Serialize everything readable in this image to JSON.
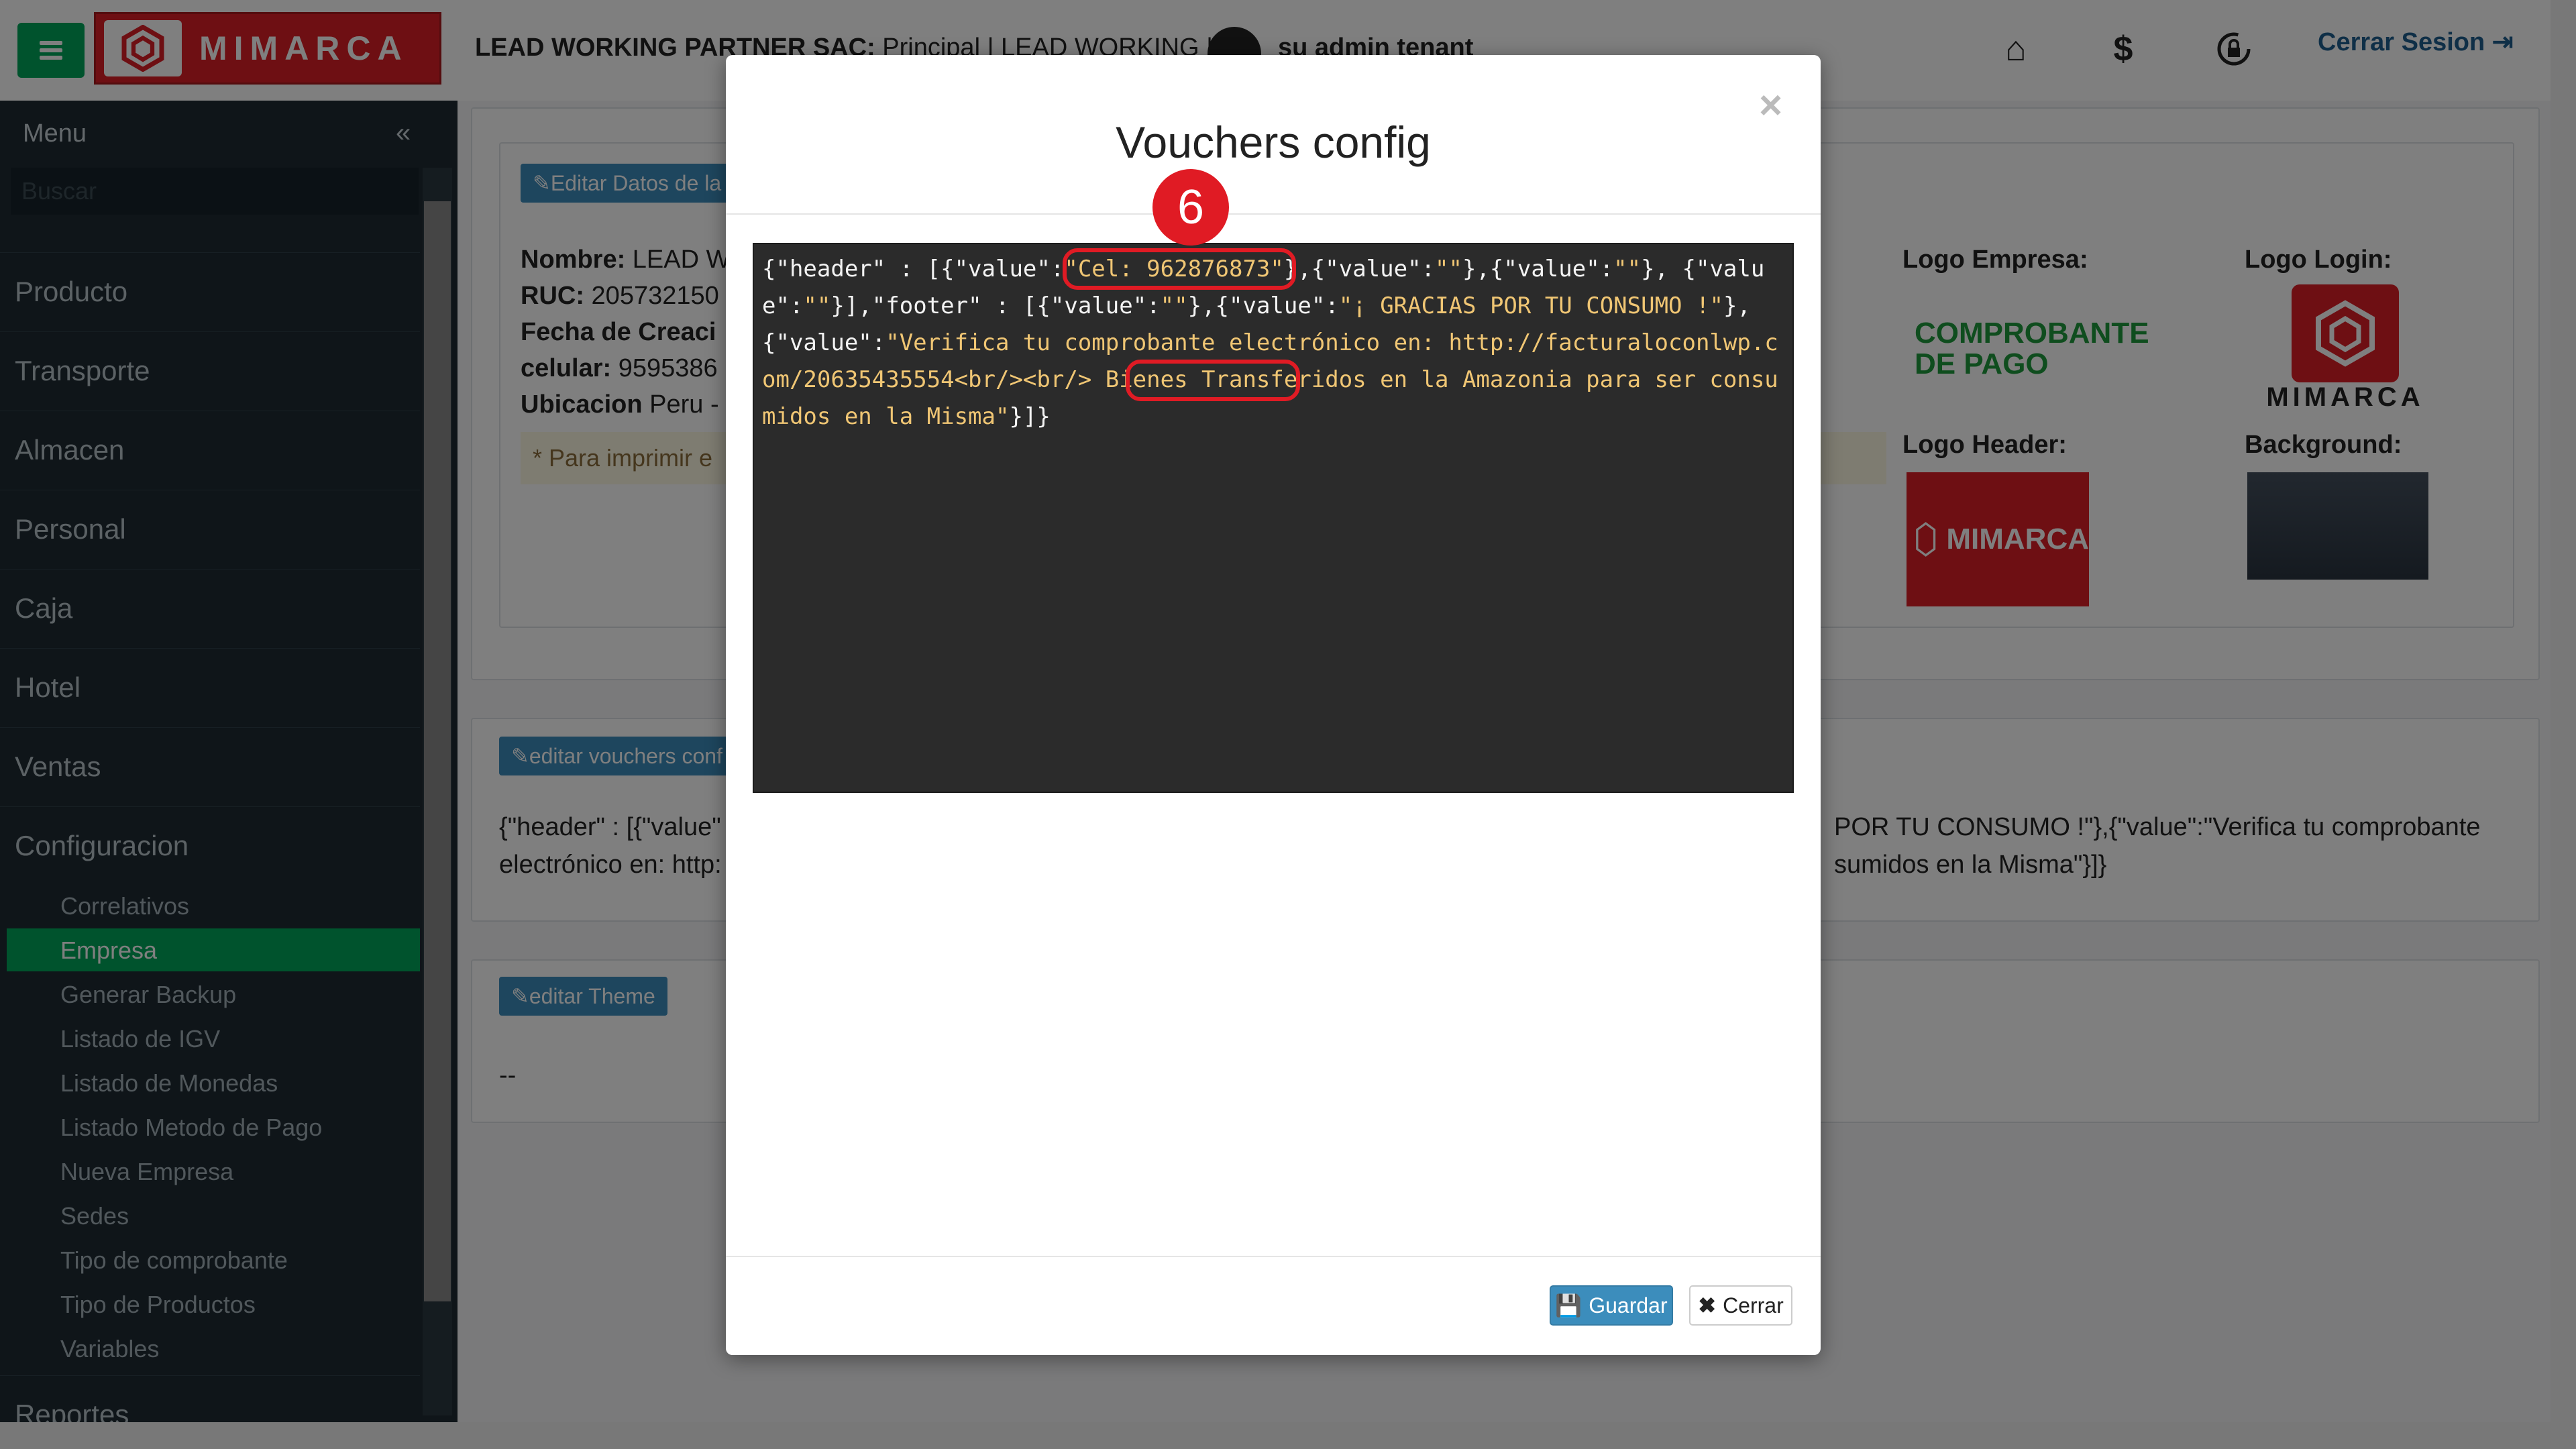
{
  "topbar": {
    "brand": "MIMARCA",
    "company_bold": "LEAD WORKING PARTNER SAC:",
    "company_rest": " Principal | LEAD WORKING |",
    "user": "su admin tenant",
    "logout_label": "Cerrar Sesion"
  },
  "sidebar": {
    "title": "Menu",
    "search_placeholder": "Buscar",
    "items": [
      "Producto",
      "Transporte",
      "Almacen",
      "Personal",
      "Caja",
      "Hotel",
      "Ventas",
      "Configuracion",
      "Reportes"
    ],
    "sub_items": [
      "Correlativos",
      "Empresa",
      "Generar Backup",
      "Listado de IGV",
      "Listado de Monedas",
      "Listado Metodo de Pago",
      "Nueva Empresa",
      "Sedes",
      "Tipo de comprobante",
      "Tipo de Productos",
      "Variables"
    ],
    "active_sub": "Empresa"
  },
  "main": {
    "edit_data_btn": "Editar Datos de la",
    "fields": [
      {
        "label": "Nombre:",
        "value": "LEAD W"
      },
      {
        "label": "RUC:",
        "value": "205732150"
      },
      {
        "label": "Fecha de Creaci",
        "value": ""
      },
      {
        "label": "celular:",
        "value": "9595386"
      },
      {
        "label": "Ubicacion",
        "value": "Peru -"
      }
    ],
    "print_note": "* Para imprimir e",
    "logo_empresa": "Logo Empresa:",
    "logo_empresa_img_text": "COMPROBANTE DE PAGO",
    "logo_login": "Logo Login:",
    "logo_header": "Logo Header:",
    "background": "Background:",
    "vouchers_btn": "editar vouchers conf",
    "vouchers_left_1": "{\"header\" : [{\"value\"",
    "vouchers_left_2": "electrónico en: http:",
    "vouchers_right_1": "POR TU CONSUMO !\"},{\"value\":\"Verifica tu comprobante",
    "vouchers_right_2": "sumidos en la Misma\"}]}",
    "theme_btn": "editar Theme",
    "theme_value": "--"
  },
  "modal": {
    "title": "Vouchers config",
    "step_number": "6",
    "json_parts": [
      {
        "t": "{\"header\" : [{\"value\":",
        "s": false
      },
      {
        "t": "\"Cel: 962876873\"",
        "s": true
      },
      {
        "t": "},{\"value\":",
        "s": false
      },
      {
        "t": "\"\"",
        "s": true
      },
      {
        "t": "},{\"value\":",
        "s": false
      },
      {
        "t": "\"\"",
        "s": true
      },
      {
        "t": "}, {\"value\":",
        "s": false
      },
      {
        "t": "\"\"",
        "s": true
      },
      {
        "t": "}],\"footer\" : [{\"value\":",
        "s": false
      },
      {
        "t": "\"\"",
        "s": true
      },
      {
        "t": "},{\"value\":",
        "s": false
      },
      {
        "t": "\"¡ GRACIAS POR TU CONSUMO !\"",
        "s": true
      },
      {
        "t": "},{\"value\":",
        "s": false
      },
      {
        "t": "\"Verifica tu comprobante electrónico en: http://facturaloconlwp.com/20635435554<br/><br/> Bienes Transferidos en la Amazonia para ser consumidos en la Misma\"",
        "s": true
      },
      {
        "t": "}]}",
        "s": false
      }
    ],
    "save_label": "Guardar",
    "close_label": "Cerrar"
  }
}
